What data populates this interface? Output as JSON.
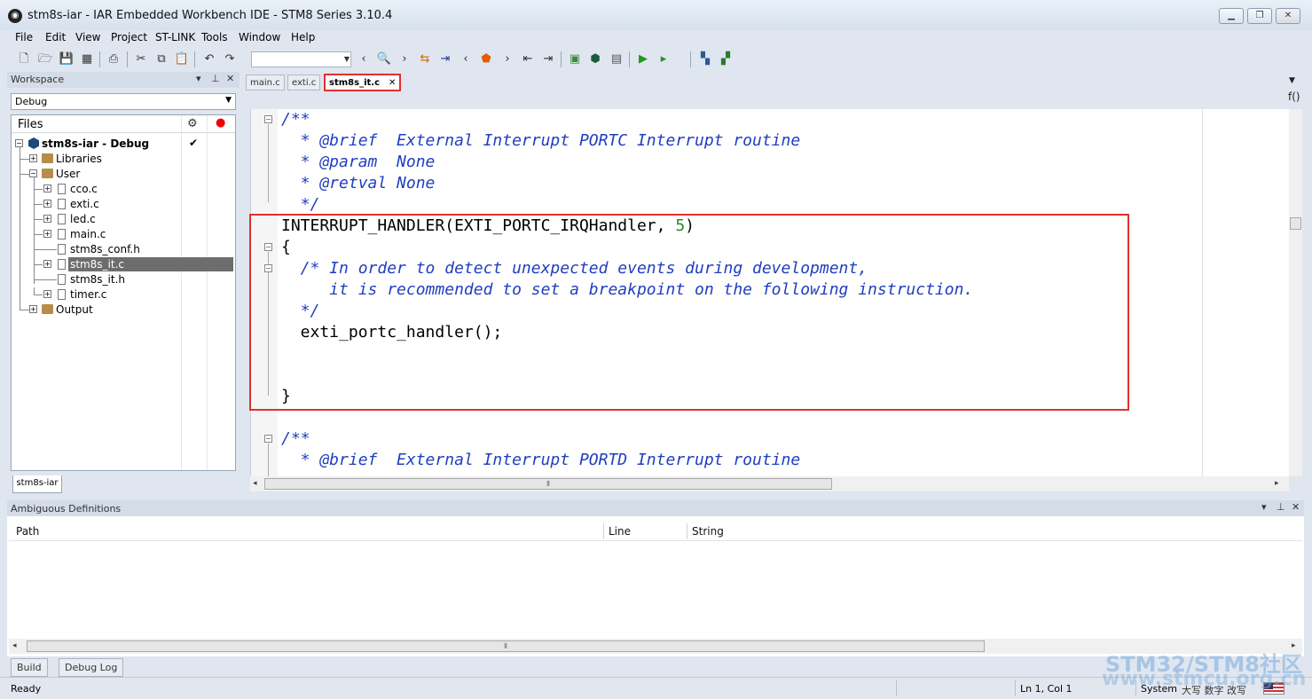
{
  "window": {
    "title": "stm8s-iar - IAR Embedded Workbench IDE - STM8 Series 3.10.4",
    "icon": "iar-logo-icon",
    "controls": [
      "minimize-icon",
      "restore-icon",
      "close-icon"
    ]
  },
  "menu": [
    "File",
    "Edit",
    "View",
    "Project",
    "ST-LINK",
    "Tools",
    "Window",
    "Help"
  ],
  "toolbar": {
    "search_value": "",
    "icons": [
      "new-file-icon",
      "open-icon",
      "save-icon",
      "save-all-icon",
      "print-icon",
      "cut-icon",
      "copy-icon",
      "paste-icon",
      "undo-icon",
      "redo-icon",
      "find-icon",
      "nav-back-icon",
      "nav-forward-icon",
      "bookmark-icon",
      "compile-icon",
      "make-icon",
      "download-debug-icon",
      "debug-without-download-icon",
      "stop-icon"
    ]
  },
  "workspace": {
    "title": "Workspace",
    "configuration": "Debug",
    "files_label": "Files",
    "tab": "stm8s-iar",
    "tree": [
      {
        "label": "stm8s-iar - Debug",
        "type": "project",
        "checked": true
      },
      {
        "label": "Libraries",
        "type": "folder"
      },
      {
        "label": "User",
        "type": "folder"
      },
      {
        "label": "cco.c",
        "type": "file"
      },
      {
        "label": "exti.c",
        "type": "file"
      },
      {
        "label": "led.c",
        "type": "file"
      },
      {
        "label": "main.c",
        "type": "file"
      },
      {
        "label": "stm8s_conf.h",
        "type": "file"
      },
      {
        "label": "stm8s_it.c",
        "type": "file",
        "selected": true
      },
      {
        "label": "stm8s_it.h",
        "type": "file"
      },
      {
        "label": "timer.c",
        "type": "file"
      },
      {
        "label": "Output",
        "type": "folder"
      }
    ]
  },
  "editor": {
    "tabs": [
      {
        "label": "main.c",
        "active": false
      },
      {
        "label": "exti.c",
        "active": false
      },
      {
        "label": "stm8s_it.c",
        "active": true
      }
    ],
    "func_button": "f()",
    "lines": [
      {
        "text": "/**",
        "kind": "comment"
      },
      {
        "text": "  * @brief  External Interrupt PORTC Interrupt routine",
        "kind": "comment"
      },
      {
        "text": "  * @param  None",
        "kind": "comment"
      },
      {
        "text": "  * @retval None",
        "kind": "comment"
      },
      {
        "text": "  */",
        "kind": "comment"
      },
      {
        "text": "INTERRUPT_HANDLER(EXTI_PORTC_IRQHandler, ",
        "kind": "code",
        "num": "5",
        "tail": ")"
      },
      {
        "text": "{",
        "kind": "code"
      },
      {
        "text": "  /* In order to detect unexpected events during development,",
        "kind": "comment"
      },
      {
        "text": "     it is recommended to set a breakpoint on the following instruction.",
        "kind": "comment"
      },
      {
        "text": "  */",
        "kind": "comment"
      },
      {
        "text": "  exti_portc_handler();",
        "kind": "code"
      },
      {
        "text": "",
        "kind": "code"
      },
      {
        "text": "",
        "kind": "code"
      },
      {
        "text": "}",
        "kind": "code"
      },
      {
        "text": "",
        "kind": "code"
      },
      {
        "text": "/**",
        "kind": "comment"
      },
      {
        "text": "  * @brief  External Interrupt PORTD Interrupt routine",
        "kind": "comment"
      }
    ]
  },
  "bottom_panel": {
    "title": "Ambiguous Definitions",
    "columns": [
      "Path",
      "Line",
      "String"
    ],
    "tabs": [
      "Build",
      "Debug Log"
    ]
  },
  "status": {
    "ready": "Ready",
    "position": "Ln 1, Col 1",
    "system": "System",
    "ime": "大写 数字 改写"
  },
  "watermark": {
    "line1": "STM32/STM8社区",
    "line2": "www.stmcu.org.cn"
  }
}
